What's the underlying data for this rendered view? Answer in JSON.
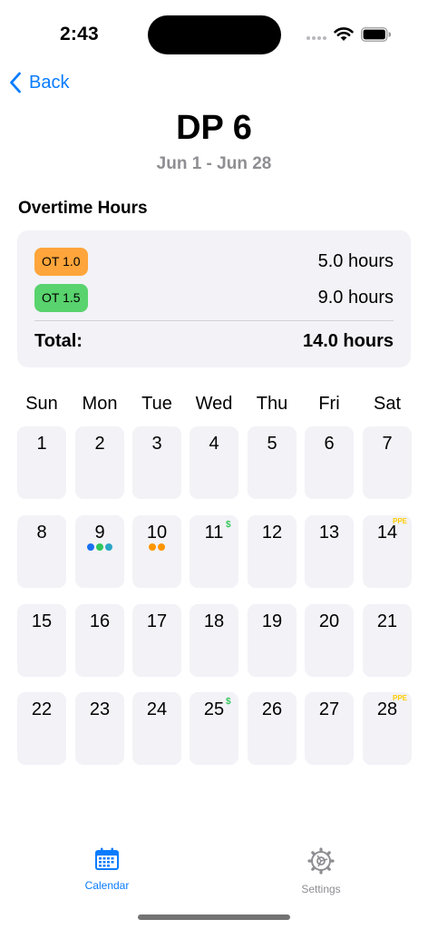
{
  "status_bar": {
    "time": "2:43"
  },
  "nav": {
    "back_label": "Back"
  },
  "header": {
    "title": "DP 6",
    "subtitle": "Jun 1 - Jun 28"
  },
  "overtime": {
    "section_title": "Overtime Hours",
    "rows": [
      {
        "badge": "OT 1.0",
        "badge_color": "#ffa53b",
        "hours": "5.0 hours"
      },
      {
        "badge": "OT 1.5",
        "badge_color": "#59d36d",
        "hours": "9.0 hours"
      }
    ],
    "total_label": "Total:",
    "total_value": "14.0 hours"
  },
  "calendar": {
    "weekdays": [
      "Sun",
      "Mon",
      "Tue",
      "Wed",
      "Thu",
      "Fri",
      "Sat"
    ],
    "dot_colors": {
      "blue": "#1a6ff0",
      "green": "#2fc75a",
      "teal": "#2aa6c4",
      "orange": "#ff9500"
    },
    "days": [
      {
        "n": "1"
      },
      {
        "n": "2"
      },
      {
        "n": "3"
      },
      {
        "n": "4"
      },
      {
        "n": "5"
      },
      {
        "n": "6"
      },
      {
        "n": "7"
      },
      {
        "n": "8"
      },
      {
        "n": "9",
        "dots": [
          "blue",
          "green",
          "teal"
        ]
      },
      {
        "n": "10",
        "dots": [
          "orange",
          "orange"
        ]
      },
      {
        "n": "11",
        "marker": "$"
      },
      {
        "n": "12"
      },
      {
        "n": "13"
      },
      {
        "n": "14",
        "tag": "PPE"
      },
      {
        "n": "15"
      },
      {
        "n": "16"
      },
      {
        "n": "17"
      },
      {
        "n": "18"
      },
      {
        "n": "19"
      },
      {
        "n": "20"
      },
      {
        "n": "21"
      },
      {
        "n": "22"
      },
      {
        "n": "23"
      },
      {
        "n": "24"
      },
      {
        "n": "25",
        "marker": "$"
      },
      {
        "n": "26"
      },
      {
        "n": "27"
      },
      {
        "n": "28",
        "tag": "PPE"
      }
    ]
  },
  "tab_bar": {
    "active_color": "#0a7cff",
    "inactive_color": "#8e8e93",
    "tabs": [
      {
        "label": "Calendar",
        "icon": "calendar-icon",
        "active": true
      },
      {
        "label": "Settings",
        "icon": "gear-icon",
        "active": false
      }
    ]
  }
}
